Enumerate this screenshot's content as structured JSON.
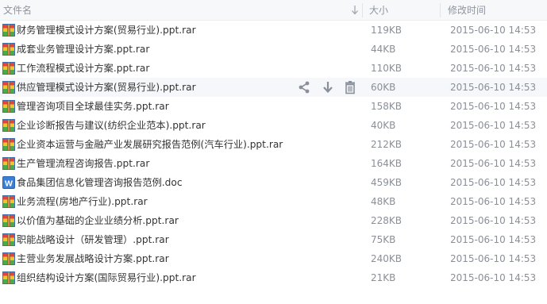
{
  "columns": {
    "name": "文件名",
    "size": "大小",
    "time": "修改时间"
  },
  "files": [
    {
      "name": "财务管理模式设计方案(贸易行业).ppt.rar",
      "size": "119KB",
      "time": "2015-06-10 14:53",
      "icon": "rar-archive-icon"
    },
    {
      "name": "成套业务管理设计方案.ppt.rar",
      "size": "44KB",
      "time": "2015-06-10 14:53",
      "icon": "rar-archive-icon"
    },
    {
      "name": "工作流程模式设计方案.ppt.rar",
      "size": "110KB",
      "time": "2015-06-10 14:53",
      "icon": "rar-archive-icon"
    },
    {
      "name": "供应管理模式设计方案(贸易行业).ppt.rar",
      "size": "60KB",
      "time": "2015-06-10 14:53",
      "icon": "rar-archive-icon"
    },
    {
      "name": "管理咨询项目全球最佳实务.ppt.rar",
      "size": "158KB",
      "time": "2015-06-10 14:53",
      "icon": "rar-archive-icon"
    },
    {
      "name": "企业诊断报告与建议(纺织企业范本).ppt.rar",
      "size": "40KB",
      "time": "2015-06-10 14:53",
      "icon": "rar-archive-icon"
    },
    {
      "name": "企业资本运营与金融产业发展研究报告范例(汽车行业).ppt.rar",
      "size": "212KB",
      "time": "2015-06-10 14:53",
      "icon": "rar-archive-icon"
    },
    {
      "name": "生产管理流程咨询报告.ppt.rar",
      "size": "164KB",
      "time": "2015-06-10 14:53",
      "icon": "rar-archive-icon"
    },
    {
      "name": "食品集团信息化管理咨询报告范例.doc",
      "size": "459KB",
      "time": "2015-06-10 14:53",
      "icon": "word-doc-icon"
    },
    {
      "name": "业务流程(房地产行业).ppt.rar",
      "size": "48KB",
      "time": "2015-06-10 14:53",
      "icon": "rar-archive-icon"
    },
    {
      "name": "以价值为基础的企业业绩分析.ppt.rar",
      "size": "228KB",
      "time": "2015-06-10 14:53",
      "icon": "rar-archive-icon"
    },
    {
      "name": "职能战略设计（研发管理）.ppt.rar",
      "size": "75KB",
      "time": "2015-06-10 14:53",
      "icon": "rar-archive-icon"
    },
    {
      "name": "主营业务发展战略设计方案.ppt.rar",
      "size": "240KB",
      "time": "2015-06-10 14:53",
      "icon": "rar-archive-icon"
    },
    {
      "name": "组织结构设计方案(国际贸易行业).ppt.rar",
      "size": "21KB",
      "time": "2015-06-10 14:53",
      "icon": "rar-archive-icon"
    }
  ],
  "hover_row_index": 3,
  "row_actions": [
    "share-icon",
    "download-icon",
    "delete-icon"
  ]
}
